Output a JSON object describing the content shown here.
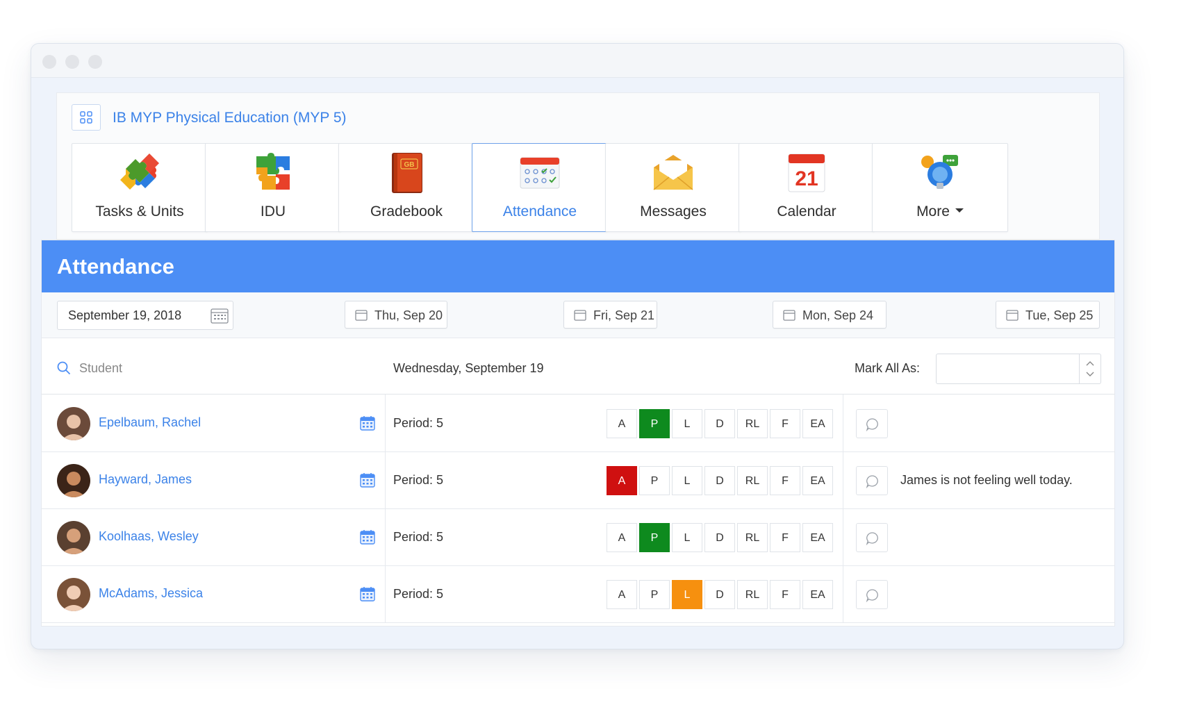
{
  "course": {
    "title": "IB MYP Physical Education (MYP 5)"
  },
  "nav_tiles": [
    {
      "label": "Tasks & Units",
      "icon": "puzzle-icon"
    },
    {
      "label": "IDU",
      "icon": "puzzle-pieces-icon"
    },
    {
      "label": "Gradebook",
      "icon": "gradebook-book-icon"
    },
    {
      "label": "Attendance",
      "icon": "attendance-calendar-icon",
      "active": true
    },
    {
      "label": "Messages",
      "icon": "envelope-icon"
    },
    {
      "label": "Calendar",
      "icon": "calendar-21-icon"
    },
    {
      "label": "More",
      "icon": "lightbulb-icon"
    }
  ],
  "icon_text": {
    "gradebook": "GB",
    "calendar_day": "21"
  },
  "header": {
    "title": "Attendance"
  },
  "dates": {
    "current": "September 19, 2018",
    "buttons": [
      "Thu, Sep 20",
      "Fri, Sep 21",
      "Mon, Sep 24",
      "Tue, Sep 25"
    ]
  },
  "filter": {
    "search_placeholder": "Student",
    "day_label": "Wednesday, September 19",
    "mark_all_label": "Mark All As:"
  },
  "codes": [
    "A",
    "P",
    "L",
    "D",
    "RL",
    "F",
    "EA"
  ],
  "students": [
    {
      "name": "Epelbaum, Rachel",
      "period": "Period: 5",
      "selected": "P",
      "note": ""
    },
    {
      "name": "Hayward, James",
      "period": "Period: 5",
      "selected": "A",
      "note": "James is not feeling well today."
    },
    {
      "name": "Koolhaas, Wesley",
      "period": "Period: 5",
      "selected": "P",
      "note": ""
    },
    {
      "name": "McAdams, Jessica",
      "period": "Period: 5",
      "selected": "L",
      "note": ""
    }
  ],
  "colors": {
    "accent": "#4c8ef5",
    "link": "#3b82e8",
    "present": "#0e8a1e",
    "absent": "#cf1010",
    "late": "#f6900f"
  }
}
